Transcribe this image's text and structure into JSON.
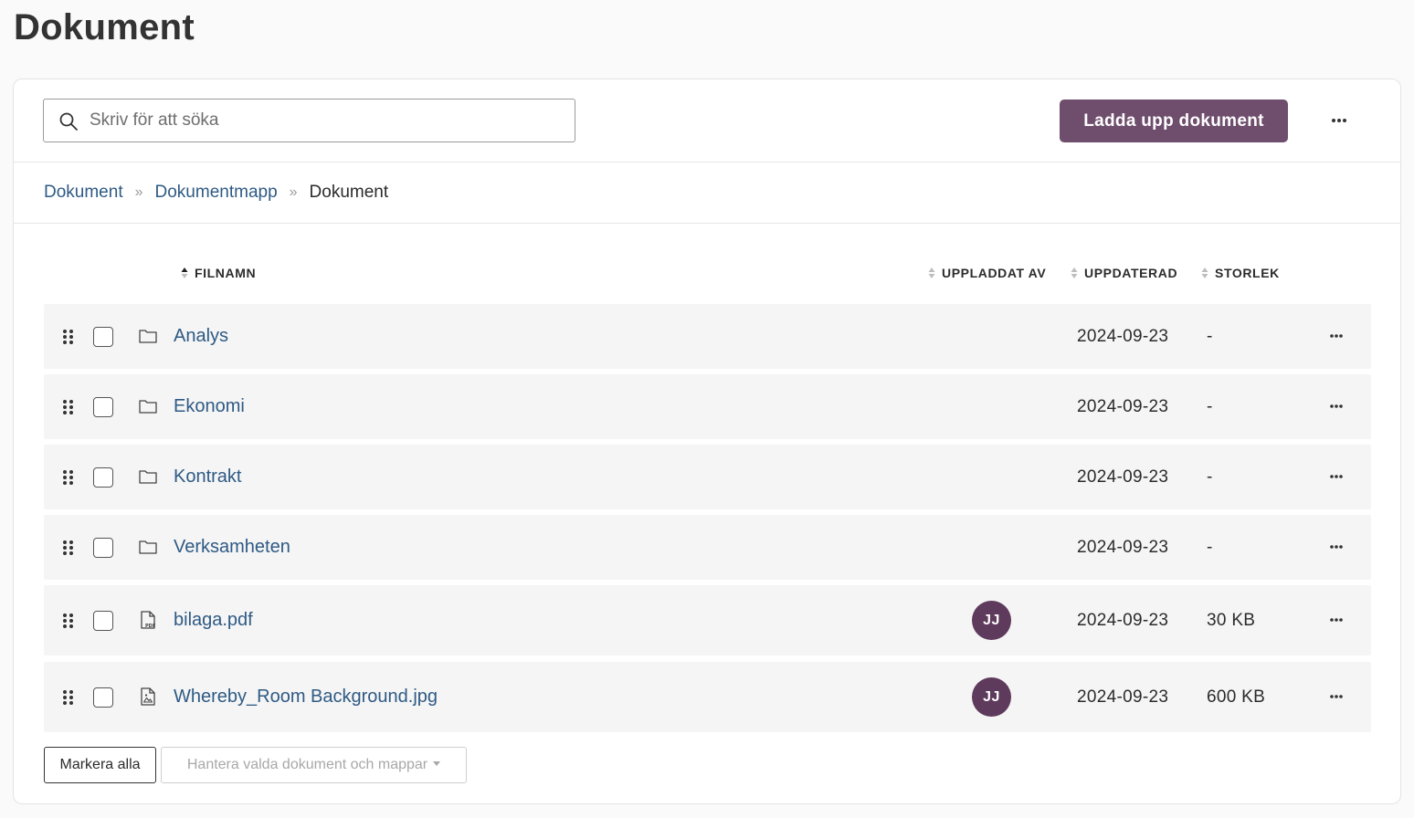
{
  "page": {
    "title": "Dokument"
  },
  "toolbar": {
    "search_placeholder": "Skriv för att söka",
    "search_value": "",
    "upload_label": "Ladda upp dokument",
    "more_icon": "ellipsis-icon"
  },
  "breadcrumb": {
    "items": [
      {
        "label": "Dokument",
        "link": true
      },
      {
        "label": "Dokumentmapp",
        "link": true
      },
      {
        "label": "Dokument",
        "link": false
      }
    ]
  },
  "table": {
    "columns": {
      "filename": "FILNAMN",
      "uploaded_by": "UPPLADDAT AV",
      "updated": "UPPDATERAD",
      "size": "STORLEK"
    },
    "sort": {
      "column": "filename",
      "direction": "ascending"
    },
    "rows": [
      {
        "type": "folder",
        "name": "Analys",
        "uploaded_by": "",
        "updated": "2024-09-23",
        "size": "-"
      },
      {
        "type": "folder",
        "name": "Ekonomi",
        "uploaded_by": "",
        "updated": "2024-09-23",
        "size": "-"
      },
      {
        "type": "folder",
        "name": "Kontrakt",
        "uploaded_by": "",
        "updated": "2024-09-23",
        "size": "-"
      },
      {
        "type": "folder",
        "name": "Verksamheten",
        "uploaded_by": "",
        "updated": "2024-09-23",
        "size": "-"
      },
      {
        "type": "pdf",
        "name": "bilaga.pdf",
        "uploaded_by": "JJ",
        "updated": "2024-09-23",
        "size": "30 KB"
      },
      {
        "type": "image",
        "name": "Whereby_Room Background.jpg",
        "uploaded_by": "JJ",
        "updated": "2024-09-23",
        "size": "600 KB"
      }
    ]
  },
  "footer": {
    "select_all_label": "Markera alla",
    "manage_label": "Hantera valda dokument och mappar"
  },
  "colors": {
    "primary_button": "#6f4e6d",
    "avatar": "#5e3a5c",
    "link": "#2e5a84"
  }
}
